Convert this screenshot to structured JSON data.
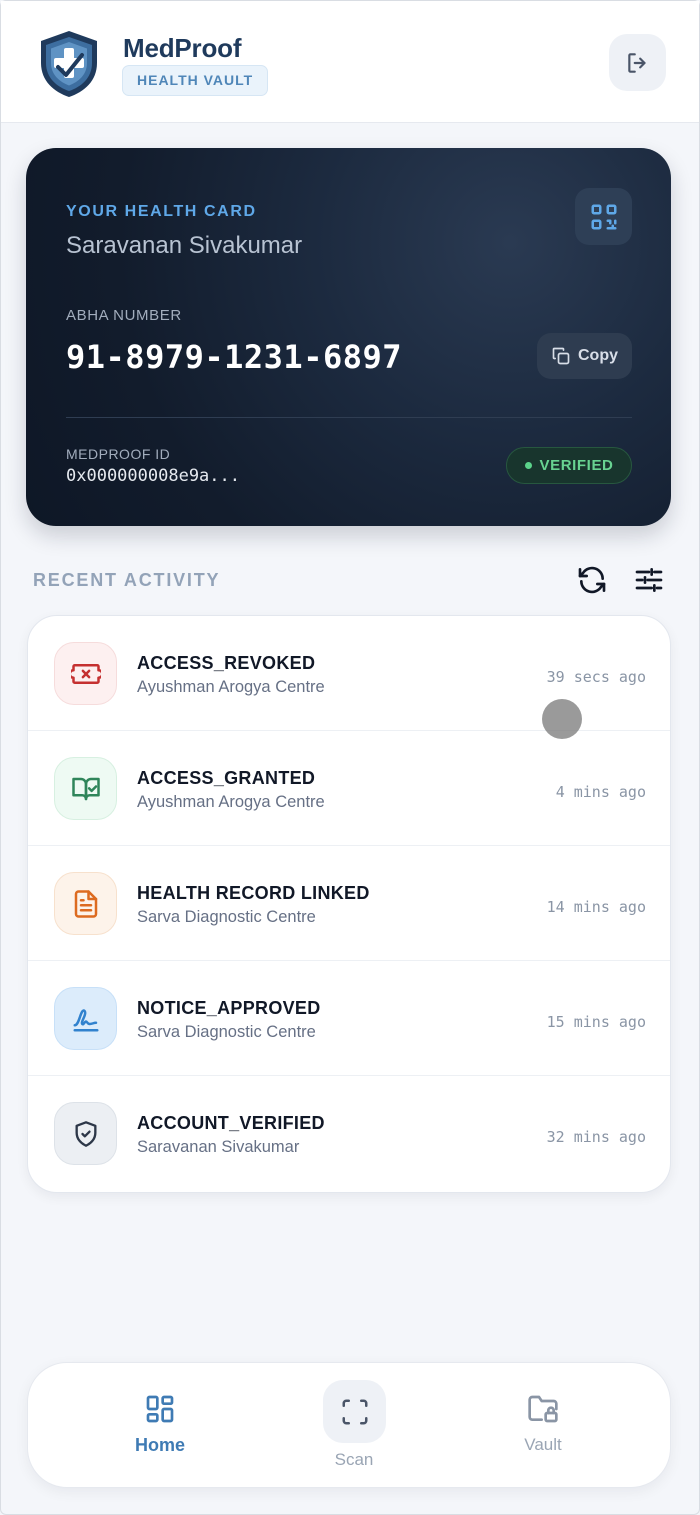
{
  "header": {
    "brand_title": "MedProof",
    "brand_badge": "HEALTH VAULT",
    "logo_icon": "shield-check-logo",
    "logout_icon": "logout-icon"
  },
  "card": {
    "eyebrow": "YOUR HEALTH CARD",
    "name": "Saravanan Sivakumar",
    "abha_label": "ABHA NUMBER",
    "abha_number": "91-8979-1231-6897",
    "copy_label": "Copy",
    "medproof_id_label": "MEDPROOF ID",
    "medproof_id_value": "0x000000008e9a...",
    "verified_label": "VERIFIED"
  },
  "recent_activity": {
    "title": "RECENT ACTIVITY",
    "items": [
      {
        "title": "ACCESS_REVOKED",
        "subtitle": "Ayushman Arogya Centre",
        "time": "39 secs ago",
        "icon": "ticket-x-icon",
        "color": "#c53030"
      },
      {
        "title": "ACCESS_GRANTED",
        "subtitle": "Ayushman Arogya Centre",
        "time": "4 mins ago",
        "icon": "book-check-icon",
        "color": "#2f855a"
      },
      {
        "title": "HEALTH RECORD LINKED",
        "subtitle": "Sarva Diagnostic Centre",
        "time": "14 mins ago",
        "icon": "document-icon",
        "color": "#dd6b20"
      },
      {
        "title": "NOTICE_APPROVED",
        "subtitle": "Sarva Diagnostic Centre",
        "time": "15 mins ago",
        "icon": "signature-icon",
        "color": "#3182ce"
      },
      {
        "title": "ACCOUNT_VERIFIED",
        "subtitle": "Saravanan Sivakumar",
        "time": "32 mins ago",
        "icon": "shield-check-icon",
        "color": "#2d3748"
      }
    ]
  },
  "nav": {
    "home": "Home",
    "scan": "Scan",
    "vault": "Vault"
  },
  "colors": {
    "accent": "#3f7bb4",
    "card_bg": "#131d2e",
    "verified": "#68d391"
  }
}
